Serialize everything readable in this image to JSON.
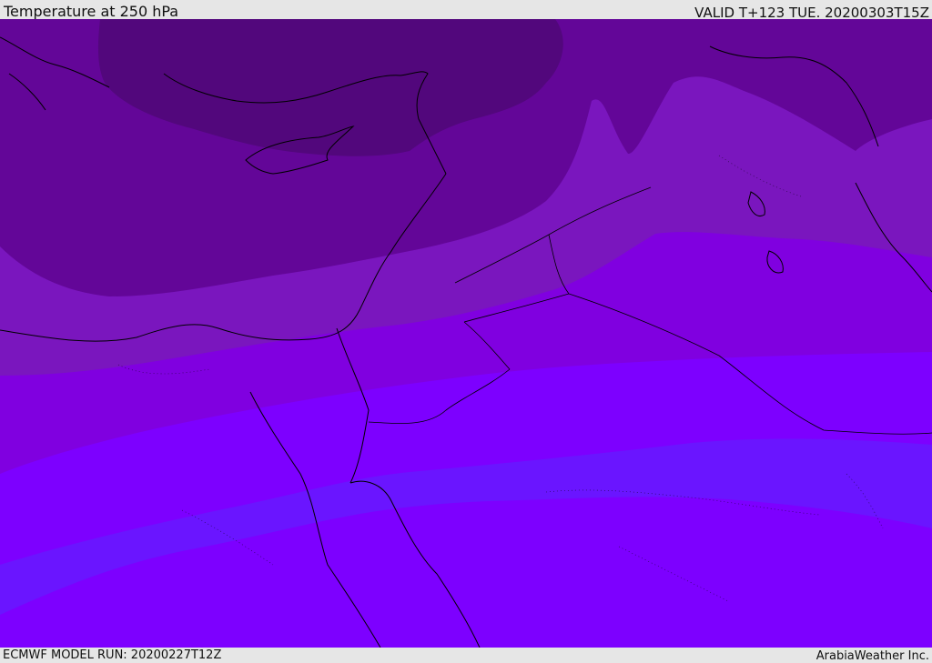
{
  "header": {
    "title": "Temperature at 250 hPa",
    "valid_time": "VALID T+123 TUE. 20200303T15Z"
  },
  "footer": {
    "model_run": "ECMWF MODEL RUN: 20200227T12Z",
    "credit": "ArabiaWeather Inc."
  },
  "colors": {
    "band_coldest": "#52077c",
    "band_cold": "#630698",
    "band_cool": "#7a16be",
    "band_mid": "#8000e0",
    "band_warm": "#7d00ff",
    "band_warmest": "#6a15ff",
    "coastline": "#000000"
  }
}
